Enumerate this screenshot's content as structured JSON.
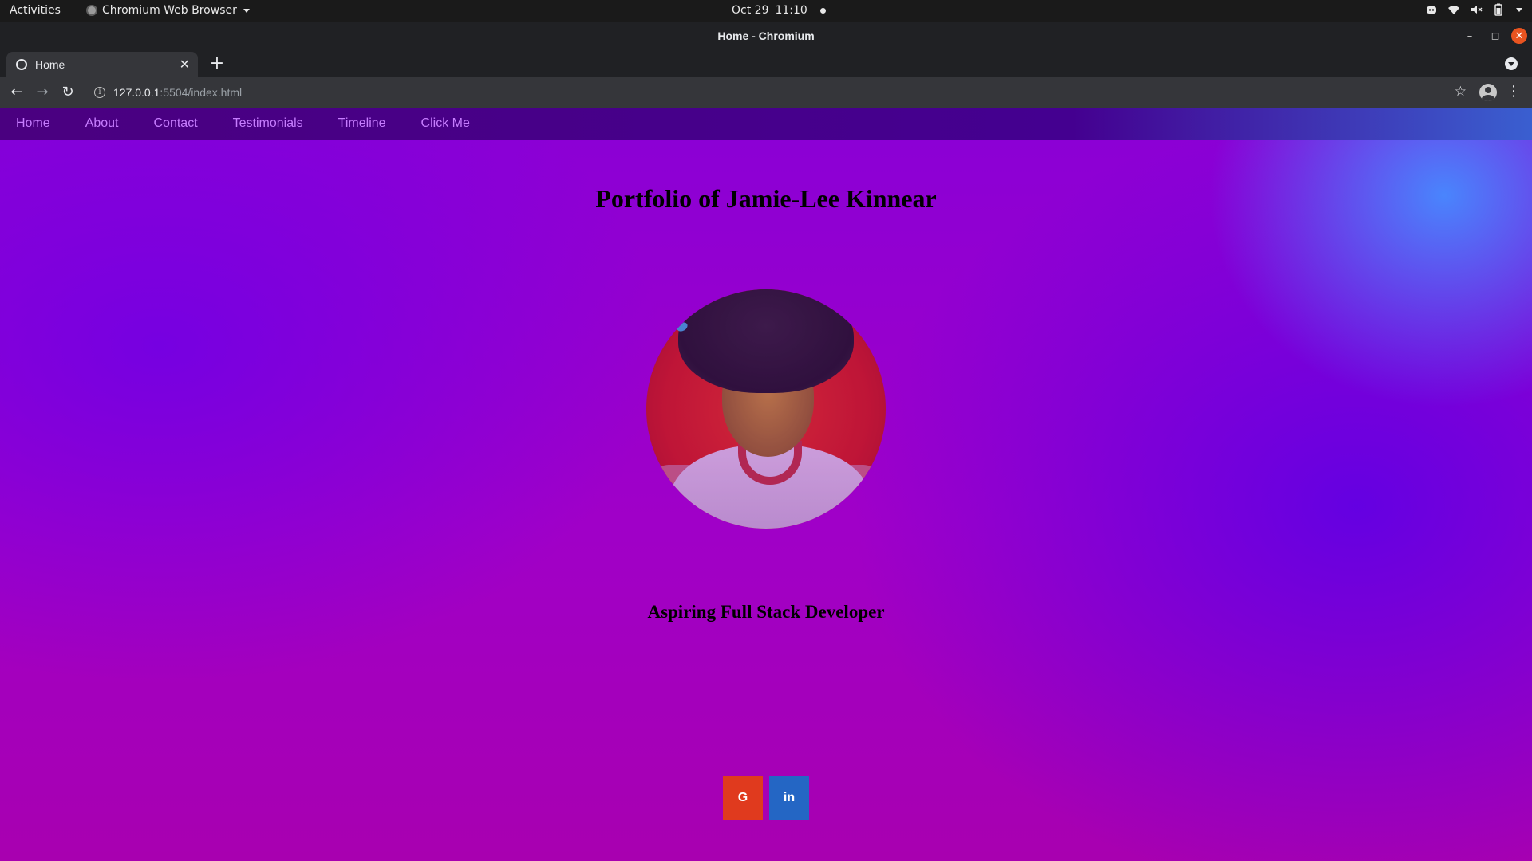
{
  "os": {
    "activities": "Activities",
    "app_name": "Chromium Web Browser",
    "date": "Oct 29",
    "time": "11:10"
  },
  "browser": {
    "window_title": "Home - Chromium",
    "tab_title": "Home",
    "url_host": "127.0.0.1",
    "url_path": ":5504/index.html"
  },
  "site": {
    "nav": [
      "Home",
      "About",
      "Contact",
      "Testimonials",
      "Timeline",
      "Click Me"
    ],
    "title": "Portfolio of Jamie-Lee Kinnear",
    "subtitle": "Aspiring Full Stack Developer",
    "social": {
      "google": "G",
      "linkedin": "in"
    }
  },
  "colors": {
    "nav_link": "#c77dff",
    "google": "#e03a1e",
    "linkedin": "#2466c4"
  }
}
